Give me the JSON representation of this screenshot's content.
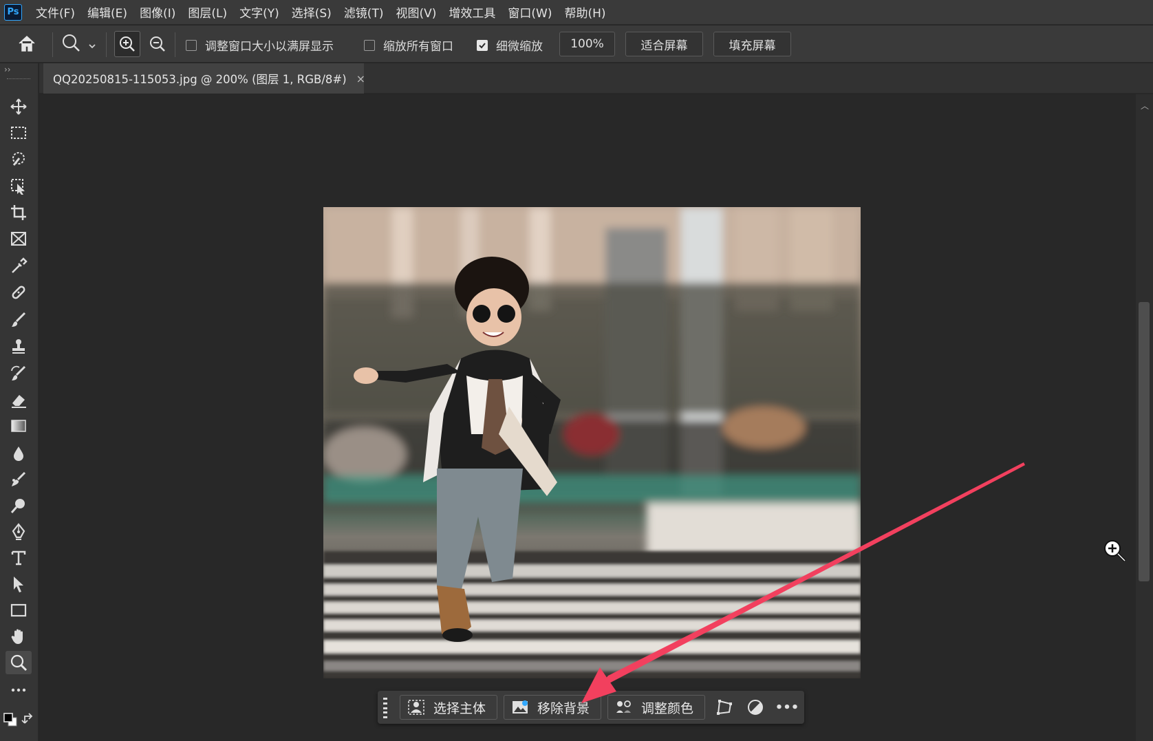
{
  "app": {
    "logo": "Ps",
    "menu": [
      "文件(F)",
      "编辑(E)",
      "图像(I)",
      "图层(L)",
      "文字(Y)",
      "选择(S)",
      "滤镜(T)",
      "视图(V)",
      "增效工具",
      "窗口(W)",
      "帮助(H)"
    ]
  },
  "options": {
    "resize_windows_label": "调整窗口大小以满屏显示",
    "resize_windows_checked": false,
    "zoom_all_label": "缩放所有窗口",
    "zoom_all_checked": false,
    "scrubby_label": "细微缩放",
    "scrubby_checked": true,
    "zoom_100": "100%",
    "fit_screen": "适合屏幕",
    "fill_screen": "填充屏幕"
  },
  "document": {
    "tab_title": "QQ20250815-115053.jpg @ 200% (图层 1, RGB/8#)",
    "close": "×"
  },
  "taskbar": {
    "select_subject": "选择主体",
    "remove_background": "移除背景",
    "adjust_color": "调整颜色",
    "more": "•••"
  },
  "colors": {
    "annotation_arrow": "#f2405e",
    "accent": "#31a8ff"
  }
}
